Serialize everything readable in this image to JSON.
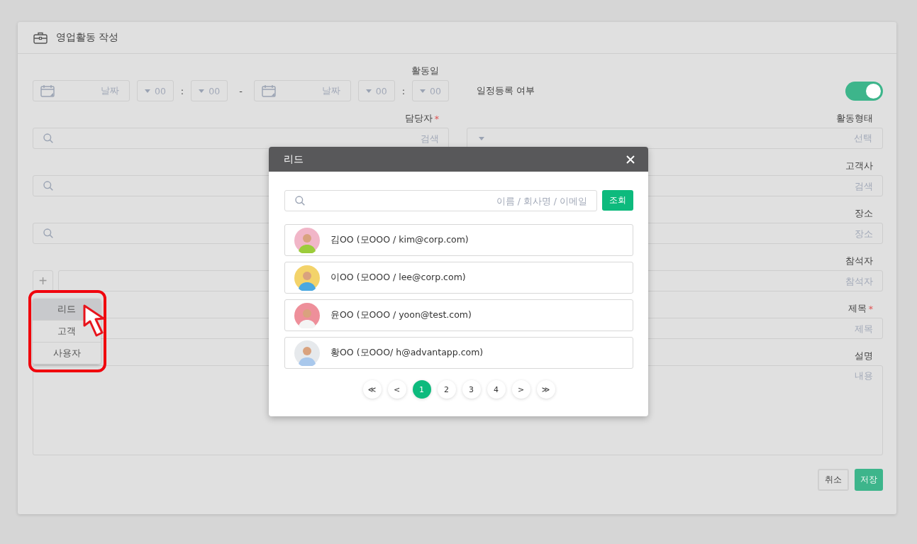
{
  "window": {
    "title": "영업활동 작성"
  },
  "date_range": {
    "label": "활동일",
    "separator": "-",
    "time_separator": ":",
    "start": {
      "placeholder": "날짜",
      "hour": "00",
      "minute": "00"
    },
    "end": {
      "placeholder": "날짜",
      "hour": "00",
      "minute": "00"
    }
  },
  "schedule_toggle": {
    "label": "일정등록 여부",
    "on": true
  },
  "rows": [
    {
      "left": {
        "label": "담당자",
        "required_mark": "*",
        "kind": "search",
        "placeholder": "검색"
      },
      "right": {
        "label": "활동형태",
        "kind": "select",
        "placeholder": "선택"
      }
    },
    {
      "left": {
        "kind": "search"
      },
      "right": {
        "label": "고객사",
        "kind": "text",
        "placeholder": "검색"
      }
    },
    {
      "left": {
        "kind": "search"
      },
      "right": {
        "label": "장소",
        "kind": "text",
        "placeholder": "장소"
      }
    },
    {
      "left": {
        "kind": "add",
        "button": "+"
      },
      "right": {
        "label": "참석자",
        "kind": "text",
        "placeholder": "참석자"
      }
    },
    {
      "left": {
        "kind": "text"
      },
      "right": {
        "label": "제목",
        "required_mark": "*",
        "kind": "text",
        "placeholder": "제목"
      }
    }
  ],
  "description": {
    "label": "설명",
    "placeholder": "내용"
  },
  "buttons": [
    {
      "label": "취소",
      "kind": "secondary"
    },
    {
      "label": "저장",
      "kind": "primary"
    }
  ],
  "add_menu": {
    "items": [
      {
        "label": "리드",
        "selected": true
      },
      {
        "label": "고객",
        "selected": false
      },
      {
        "label": "사용자",
        "selected": false
      }
    ]
  },
  "modal": {
    "title": "리드",
    "search": {
      "placeholder": "이름 / 회사명 / 이메일"
    },
    "search_button": "조회",
    "leads": [
      {
        "text": "김OO (모OOO / kim@corp.com)"
      },
      {
        "text": "이OO (모OOO / lee@corp.com)"
      },
      {
        "text": "윤OO (모OOO / yoon@test.com)"
      },
      {
        "text": "황OO (모OOO/ h@advantapp.com)"
      }
    ],
    "pagination": [
      {
        "label": "≪",
        "selected": false
      },
      {
        "label": "<",
        "selected": false
      },
      {
        "label": "1",
        "selected": true
      },
      {
        "label": "2",
        "selected": false
      },
      {
        "label": "3",
        "selected": false
      },
      {
        "label": "4",
        "selected": false
      },
      {
        "label": ">",
        "selected": false
      },
      {
        "label": "≫",
        "selected": false
      }
    ]
  }
}
